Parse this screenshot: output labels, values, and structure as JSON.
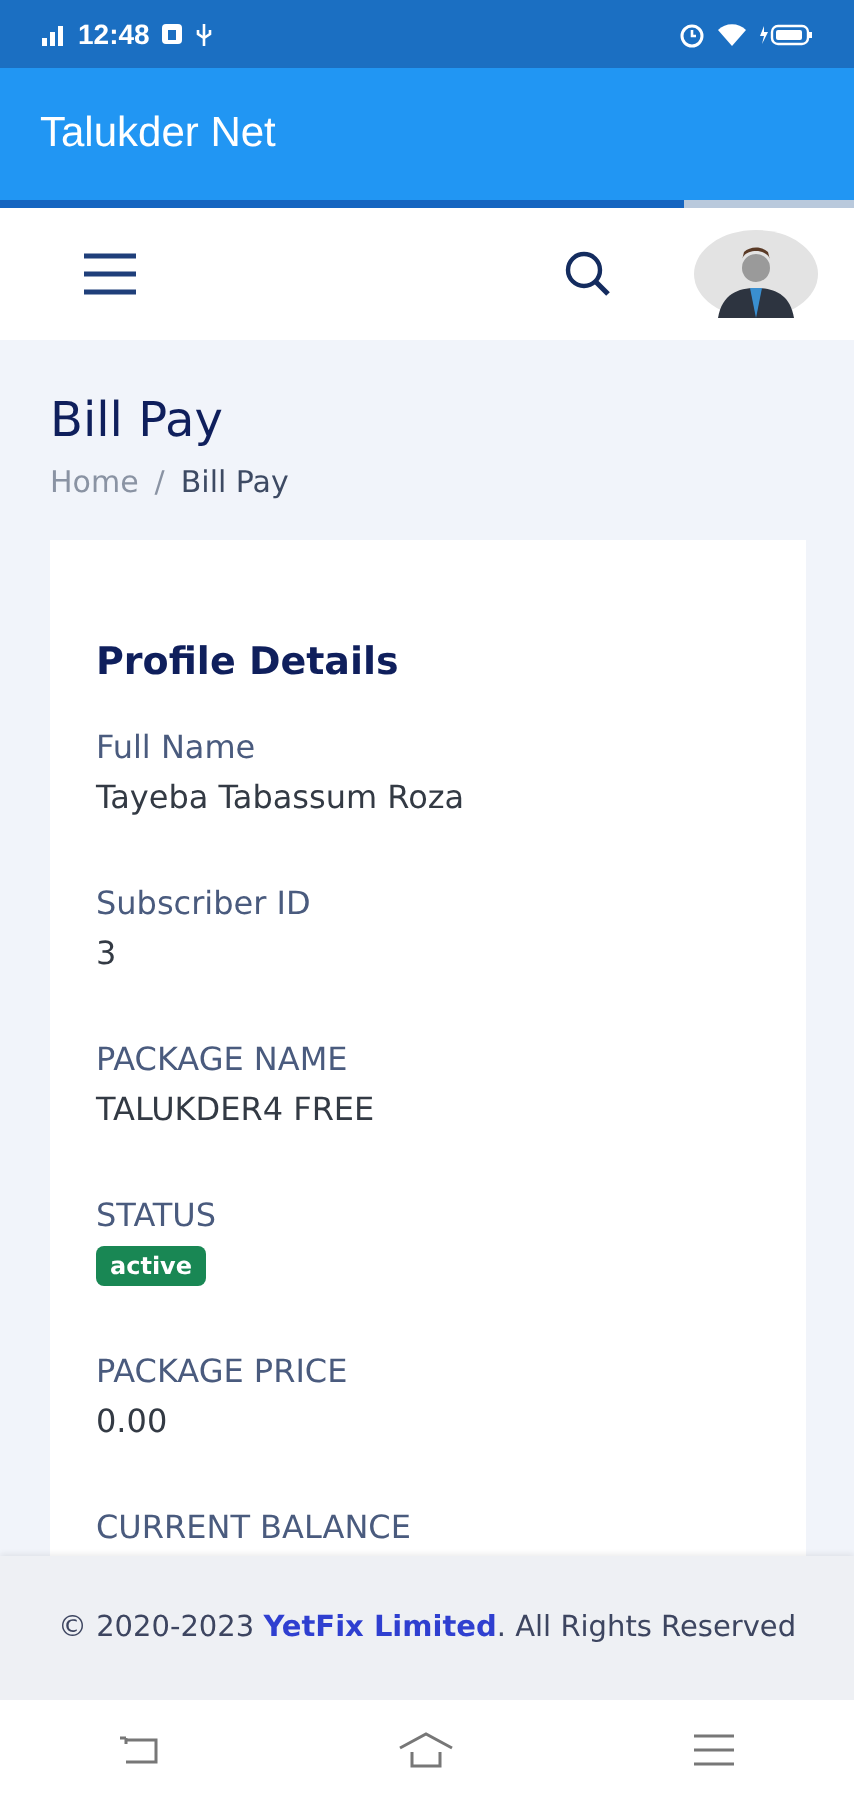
{
  "status_bar": {
    "time": "12:48"
  },
  "app_bar": {
    "title": "Talukder Net"
  },
  "loading_bar": {
    "level": 0.8
  },
  "page": {
    "title": "Bill Pay",
    "breadcrumb_separator": "/",
    "breadcrumbs": [
      {
        "label": "Home",
        "selected": false
      },
      {
        "label": "Bill Pay",
        "selected": true
      }
    ]
  },
  "card": {
    "title": "Profile Details",
    "fields": [
      {
        "label": "Full Name",
        "value": "Tayeba Tabassum Roza",
        "kind": "text"
      },
      {
        "label": "Subscriber ID",
        "value": "3",
        "kind": "text"
      },
      {
        "label": "PACKAGE NAME",
        "value": "TALUKDER4 FREE",
        "kind": "text"
      },
      {
        "label": "STATUS",
        "value": "active",
        "kind": "badge"
      },
      {
        "label": "PACKAGE PRICE",
        "value": "0.00",
        "kind": "text"
      },
      {
        "label": "CURRENT BALANCE"
      }
    ]
  },
  "footer": {
    "text_before": "© 2020-2023",
    "link": "YetFix Limited",
    "text_after": ". All Rights Reserved"
  }
}
